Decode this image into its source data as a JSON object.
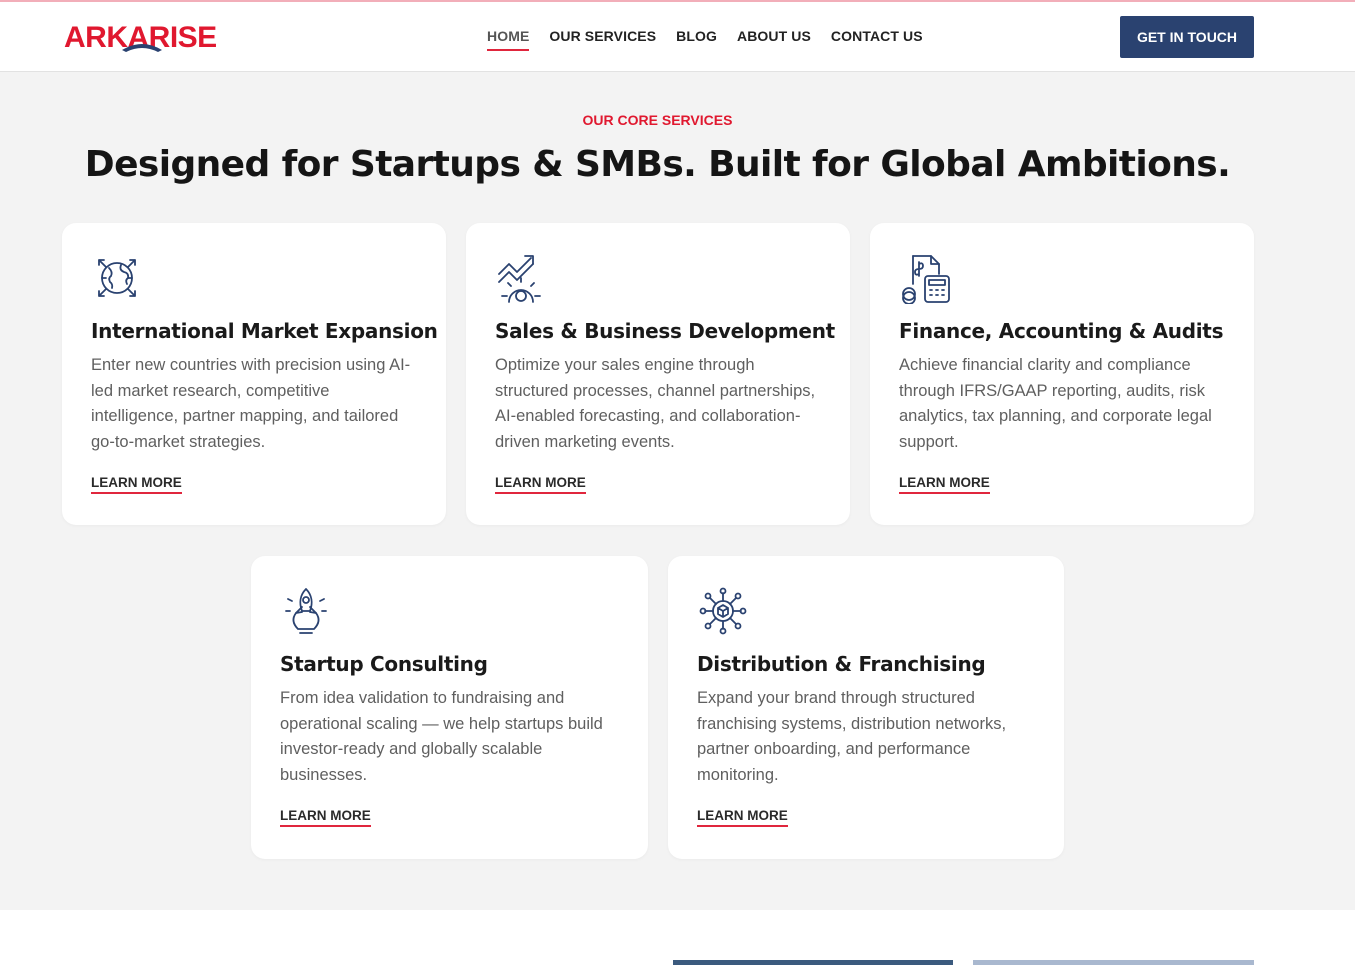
{
  "brand": {
    "name": "ARKARISE",
    "color": "#e0182f",
    "accent": "#2a4270"
  },
  "nav": {
    "items": [
      {
        "label": "HOME",
        "active": true
      },
      {
        "label": "OUR SERVICES",
        "active": false
      },
      {
        "label": "BLOG",
        "active": false
      },
      {
        "label": "ABOUT US",
        "active": false
      },
      {
        "label": "CONTACT US",
        "active": false
      }
    ],
    "cta_label": "GET IN TOUCH"
  },
  "section": {
    "eyebrow": "OUR CORE SERVICES",
    "title": "Designed for Startups & SMBs. Built for Global Ambitions."
  },
  "services": [
    {
      "icon": "globe-arrows-icon",
      "title": "International Market Expansion",
      "description": "Enter new countries with precision using AI-led market research, competitive intelligence, partner mapping, and tailored go-to-market strategies.",
      "link": "LEARN MORE"
    },
    {
      "icon": "growth-gear-icon",
      "title": "Sales & Business Development",
      "description": "Optimize your sales engine through structured processes, channel partnerships, AI-enabled forecasting, and collaboration-driven marketing events.",
      "link": "LEARN MORE"
    },
    {
      "icon": "calculator-document-icon",
      "title": "Finance, Accounting & Audits",
      "description": "Achieve financial clarity and compliance through IFRS/GAAP reporting, audits, risk analytics, tax planning, and corporate legal support.",
      "link": "LEARN MORE"
    },
    {
      "icon": "rocket-bulb-icon",
      "title": "Startup Consulting",
      "description": "From idea validation to fundraising and operational scaling — we help startups build investor-ready and globally scalable businesses.",
      "link": "LEARN MORE"
    },
    {
      "icon": "network-box-icon",
      "title": "Distribution & Franchising",
      "description": "Expand your brand through structured franchising systems, distribution networks, partner onboarding, and performance monitoring.",
      "link": "LEARN MORE"
    }
  ]
}
